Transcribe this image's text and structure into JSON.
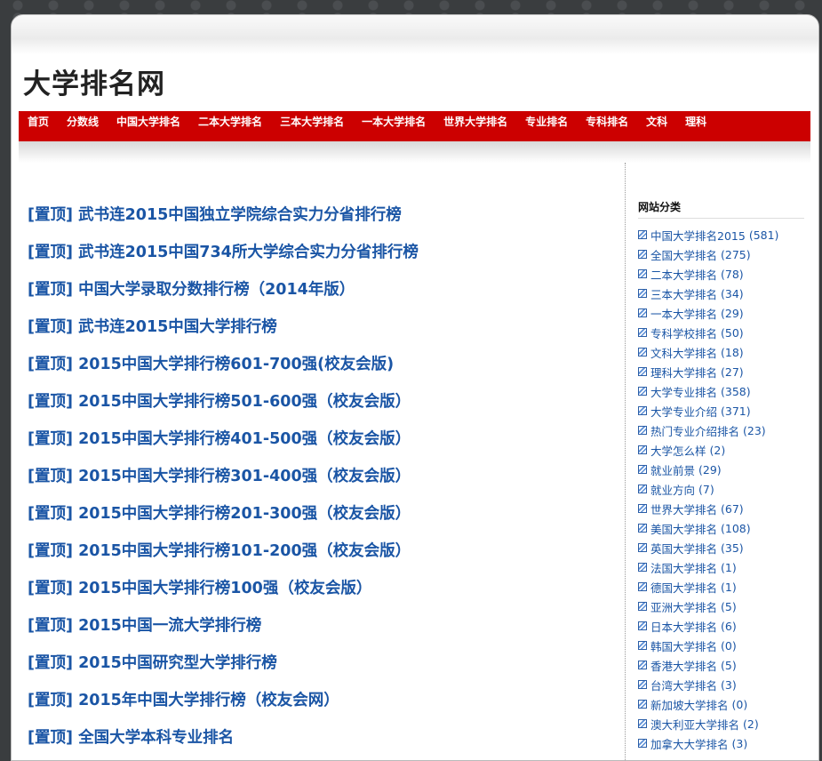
{
  "site": {
    "title": "大学排名网"
  },
  "nav": {
    "items": [
      "首页",
      "分数线",
      "中国大学排名",
      "二本大学排名",
      "三本大学排名",
      "一本大学排名",
      "世界大学排名",
      "专业排名",
      "专科排名",
      "文科",
      "理科"
    ]
  },
  "posts": [
    "[置顶] 武书连2015中国独立学院综合实力分省排行榜",
    "[置顶] 武书连2015中国734所大学综合实力分省排行榜",
    "[置顶] 中国大学录取分数排行榜（2014年版）",
    "[置顶] 武书连2015中国大学排行榜",
    "[置顶] 2015中国大学排行榜601-700强(校友会版)",
    "[置顶] 2015中国大学排行榜501-600强（校友会版）",
    "[置顶] 2015中国大学排行榜401-500强（校友会版）",
    "[置顶] 2015中国大学排行榜301-400强（校友会版）",
    "[置顶] 2015中国大学排行榜201-300强（校友会版）",
    "[置顶] 2015中国大学排行榜101-200强（校友会版）",
    "[置顶] 2015中国大学排行榜100强（校友会版）",
    "[置顶] 2015中国一流大学排行榜",
    "[置顶] 2015中国研究型大学排行榜",
    "[置顶] 2015年中国大学排行榜（校友会网）",
    "[置顶] 全国大学本科专业排名"
  ],
  "sidebar": {
    "title": "网站分类",
    "categories": [
      {
        "name": "中国大学排名2015",
        "count": "(581)"
      },
      {
        "name": "全国大学排名",
        "count": "(275)"
      },
      {
        "name": "二本大学排名",
        "count": "(78)"
      },
      {
        "name": "三本大学排名",
        "count": "(34)"
      },
      {
        "name": "一本大学排名",
        "count": "(29)"
      },
      {
        "name": "专科学校排名",
        "count": "(50)"
      },
      {
        "name": "文科大学排名",
        "count": "(18)"
      },
      {
        "name": "理科大学排名",
        "count": "(27)"
      },
      {
        "name": "大学专业排名",
        "count": "(358)"
      },
      {
        "name": "大学专业介绍",
        "count": "(371)"
      },
      {
        "name": "热门专业介绍排名",
        "count": "(23)"
      },
      {
        "name": "大学怎么样",
        "count": "(2)"
      },
      {
        "name": "就业前景",
        "count": "(29)"
      },
      {
        "name": "就业方向",
        "count": "(7)"
      },
      {
        "name": "世界大学排名",
        "count": "(67)"
      },
      {
        "name": "美国大学排名",
        "count": "(108)"
      },
      {
        "name": "英国大学排名",
        "count": "(35)"
      },
      {
        "name": "法国大学排名",
        "count": "(1)"
      },
      {
        "name": "德国大学排名",
        "count": "(1)"
      },
      {
        "name": "亚洲大学排名",
        "count": "(5)"
      },
      {
        "name": "日本大学排名",
        "count": "(6)"
      },
      {
        "name": "韩国大学排名",
        "count": "(0)"
      },
      {
        "name": "香港大学排名",
        "count": "(5)"
      },
      {
        "name": "台湾大学排名",
        "count": "(3)"
      },
      {
        "name": "新加坡大学排名",
        "count": "(0)"
      },
      {
        "name": "澳大利亚大学排名",
        "count": "(2)"
      },
      {
        "name": "加拿大大学排名",
        "count": "(3)"
      }
    ]
  },
  "colors": {
    "nav_bg": "#cc0000",
    "link": "#1a55a5",
    "page_bg": "#3a3d3f"
  }
}
